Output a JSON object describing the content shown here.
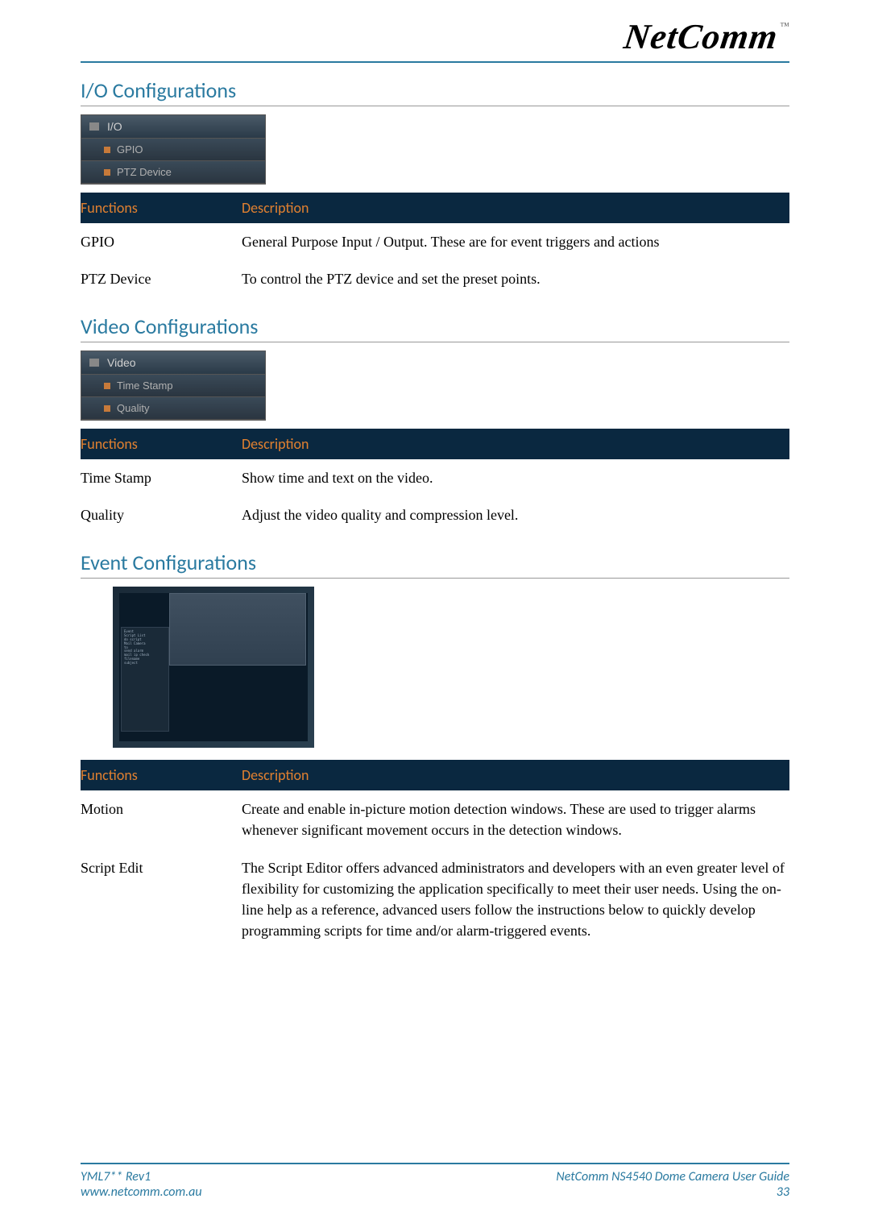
{
  "logo": {
    "brand": "NetComm",
    "tm": "™"
  },
  "sections": {
    "io": {
      "title": "I/O Configurations",
      "menu": {
        "header": "I/O",
        "items": [
          "GPIO",
          "PTZ Device"
        ]
      },
      "headers": {
        "functions": "Functions",
        "description": "Description"
      },
      "rows": [
        {
          "fn": "GPIO",
          "desc": "General Purpose Input / Output. These are for event triggers and actions"
        },
        {
          "fn": "PTZ Device",
          "desc": "To control the PTZ device and set the preset points."
        }
      ]
    },
    "video": {
      "title": "Video Configurations",
      "menu": {
        "header": "Video",
        "items": [
          "Time Stamp",
          "Quality"
        ]
      },
      "headers": {
        "functions": "Functions",
        "description": "Description"
      },
      "rows": [
        {
          "fn": "Time Stamp",
          "desc": "Show time and text on the video."
        },
        {
          "fn": "Quality",
          "desc": "Adjust the video quality and compression level."
        }
      ]
    },
    "event": {
      "title": "Event Configurations",
      "headers": {
        "functions": "Functions",
        "description": "Description"
      },
      "rows": [
        {
          "fn": "Motion",
          "desc": "Create and enable in-picture motion detection windows. These are used to trigger alarms whenever significant movement occurs in the detection windows."
        },
        {
          "fn": "Script Edit",
          "desc": "The Script Editor offers advanced administrators and developers with an even greater level of flexibility for customizing the application specifically to meet their user needs. Using the on-line help as a reference, advanced users follow the instructions below to quickly develop programming scripts for time and/or alarm-triggered events."
        }
      ]
    }
  },
  "footer": {
    "left1": "YML7** Rev1",
    "left2": "www.netcomm.com.au",
    "right1": "NetComm NS4540 Dome Camera User Guide",
    "right2": "33"
  }
}
